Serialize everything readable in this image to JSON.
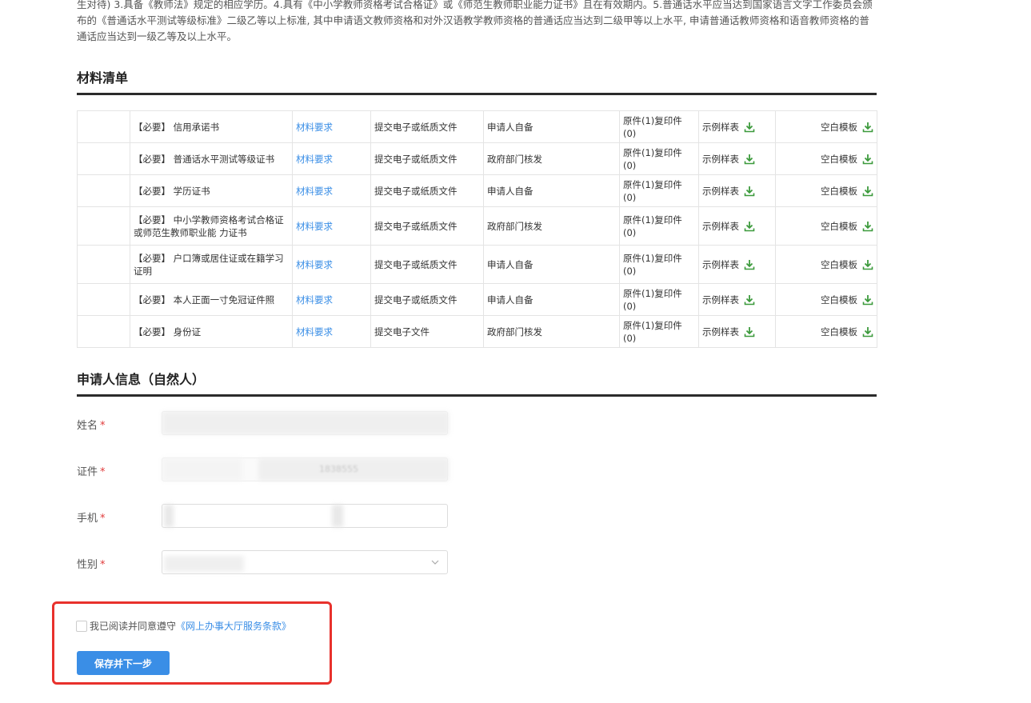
{
  "intro_text": "生对待) 3.具备《教师法》规定的相应学历。4.具有《中小学教师资格考试合格证》或《师范生教师职业能力证书》且在有效期内。5.普通话水平应当达到国家语言文字工作委员会颁布的《普通话水平测试等级标准》二级乙等以上标准, 其中申请语文教师资格和对外汉语教学教师资格的普通话应当达到二级甲等以上水平, 申请普通话教师资格和语音教师资格的普通话应当达到一级乙等及以上水平。",
  "materials": {
    "title": "材料清单",
    "rows": [
      {
        "name": "【必要】 信用承诺书",
        "req": "材料要求",
        "submit": "提交电子或纸质文件",
        "source": "申请人自备",
        "copies": "原件(1)复印件(0)",
        "sample": "示例样表",
        "template": "空白模板"
      },
      {
        "name": "【必要】 普通话水平测试等级证书",
        "req": "材料要求",
        "submit": "提交电子或纸质文件",
        "source": "政府部门核发",
        "copies": "原件(1)复印件(0)",
        "sample": "示例样表",
        "template": "空白模板"
      },
      {
        "name": "【必要】 学历证书",
        "req": "材料要求",
        "submit": "提交电子或纸质文件",
        "source": "申请人自备",
        "copies": "原件(1)复印件(0)",
        "sample": "示例样表",
        "template": "空白模板"
      },
      {
        "name": "【必要】 中小学教师资格考试合格证或师范生教师职业能 力证书",
        "req": "材料要求",
        "submit": "提交电子或纸质文件",
        "source": "政府部门核发",
        "copies": "原件(1)复印件(0)",
        "sample": "示例样表",
        "template": "空白模板"
      },
      {
        "name": "【必要】 户口簿或居住证或在籍学习证明",
        "req": "材料要求",
        "submit": "提交电子或纸质文件",
        "source": "申请人自备",
        "copies": "原件(1)复印件(0)",
        "sample": "示例样表",
        "template": "空白模板"
      },
      {
        "name": "【必要】 本人正面一寸免冠证件照",
        "req": "材料要求",
        "submit": "提交电子或纸质文件",
        "source": "申请人自备",
        "copies": "原件(1)复印件(0)",
        "sample": "示例样表",
        "template": "空白模板"
      },
      {
        "name": "【必要】 身份证",
        "req": "材料要求",
        "submit": "提交电子文件",
        "source": "政府部门核发",
        "copies": "原件(1)复印件(0)",
        "sample": "示例样表",
        "template": "空白模板"
      }
    ]
  },
  "applicant": {
    "title": "申请人信息（自然人）",
    "required_mark": "*",
    "fields": {
      "name_label": "姓名",
      "id_label": "证件",
      "id_value_partial": "1838555",
      "phone_label": "手机",
      "gender_label": "性别"
    }
  },
  "agreement": {
    "text": "我已阅读并同意遵守",
    "link": "《网上办事大厅服务条款》"
  },
  "submit_label": "保存并下一步",
  "colors": {
    "accent": "#3a8ee6",
    "required": "#e03a3a",
    "highlight": "#e8312c",
    "download_icon": "#3c9a3c"
  }
}
